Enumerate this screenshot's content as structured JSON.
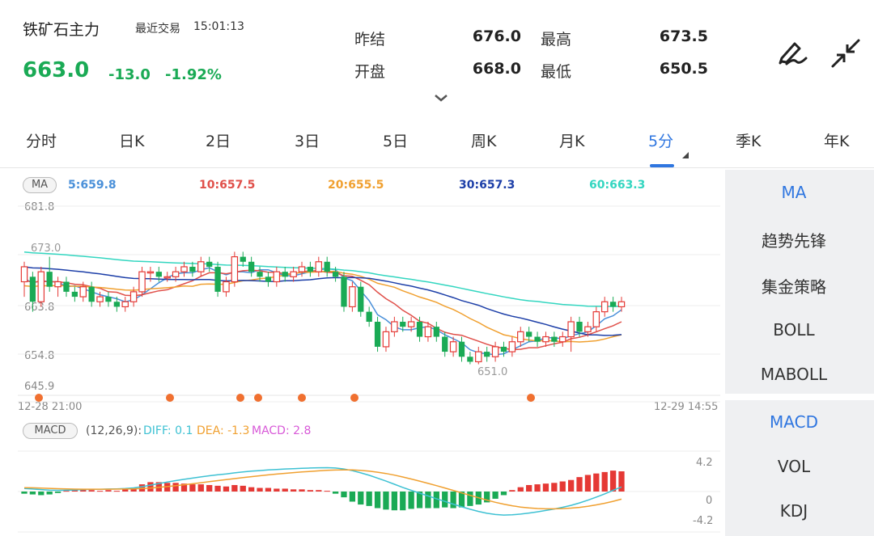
{
  "header": {
    "symbol": "铁矿石主力",
    "trade_label": "最近交易",
    "trade_time": "15:01:13",
    "last_price": "663.0",
    "change": "-13.0",
    "change_pct": "-1.92%",
    "quotes": [
      {
        "label": "昨结",
        "value": "676.0"
      },
      {
        "label": "最高",
        "value": "673.5"
      },
      {
        "label": "开盘",
        "value": "668.0"
      },
      {
        "label": "最低",
        "value": "650.5"
      }
    ],
    "colors": {
      "down": "#1aaa55",
      "up": "#e53935",
      "accent": "#2f76e0"
    }
  },
  "icons": {
    "draw": "draw-pen-icon",
    "collapse": "collapse-arrows-icon",
    "expand": "chevron-down-icon"
  },
  "tabs": [
    "分时",
    "日K",
    "2日",
    "3日",
    "5日",
    "周K",
    "月K",
    "5分",
    "季K",
    "年K"
  ],
  "active_tab": "5分",
  "ma_legend": {
    "badge": "MA",
    "items": [
      {
        "text": "5:659.8",
        "color": "#4a90d9"
      },
      {
        "text": "10:657.5",
        "color": "#e0504a"
      },
      {
        "text": "20:655.5",
        "color": "#f0a030"
      },
      {
        "text": "30:657.3",
        "color": "#1d3fa8"
      },
      {
        "text": "60:663.3",
        "color": "#33d6c0"
      }
    ]
  },
  "price_axis": [
    "681.8",
    "663.8",
    "654.8",
    "645.9"
  ],
  "time_axis": {
    "start": "12-28 21:00",
    "end": "12-29 14:55"
  },
  "annotations": {
    "high": "673.0",
    "low": "651.0"
  },
  "macd_legend": {
    "badge": "MACD",
    "params": "(12,26,9):",
    "diff": "DIFF: 0.1",
    "dea": "DEA: -1.3",
    "macd": "MACD: 2.8"
  },
  "macd_axis": [
    "4.2",
    "0",
    "-4.2"
  ],
  "side_main": [
    "MA",
    "趋势先锋",
    "集金策略",
    "BOLL",
    "MABOLL"
  ],
  "side_sub": [
    "MACD",
    "VOL",
    "KDJ"
  ],
  "chart_data": {
    "type": "candlestick",
    "candles": [
      [
        667,
        670,
        664,
        671
      ],
      [
        668,
        663,
        661,
        669
      ],
      [
        663,
        669,
        662,
        670
      ],
      [
        669,
        666,
        665,
        672
      ],
      [
        666,
        667,
        664,
        668
      ],
      [
        667,
        665,
        664,
        668
      ],
      [
        665,
        664,
        663,
        666
      ],
      [
        664,
        666,
        663,
        667
      ],
      [
        666,
        663,
        662,
        667
      ],
      [
        663,
        664,
        662,
        665
      ],
      [
        664,
        663,
        662,
        665
      ],
      [
        663,
        662,
        661,
        664
      ],
      [
        662,
        663,
        661,
        664
      ],
      [
        663,
        665,
        662,
        666
      ],
      [
        665,
        669,
        664,
        670
      ],
      [
        669,
        669,
        667,
        670
      ],
      [
        669,
        668,
        667,
        670
      ],
      [
        668,
        668,
        667,
        669
      ],
      [
        668,
        669,
        667,
        670
      ],
      [
        669,
        670,
        668,
        671
      ],
      [
        670,
        669,
        668,
        671
      ],
      [
        669,
        671,
        668,
        672
      ],
      [
        671,
        670,
        669,
        672
      ],
      [
        670,
        665,
        664,
        671
      ],
      [
        665,
        667,
        664,
        668
      ],
      [
        667,
        672,
        666,
        673
      ],
      [
        672,
        671,
        670,
        673
      ],
      [
        671,
        669,
        668,
        672
      ],
      [
        669,
        668,
        667,
        670
      ],
      [
        668,
        667,
        666,
        669
      ],
      [
        667,
        669,
        666,
        670
      ],
      [
        669,
        668,
        667,
        670
      ],
      [
        668,
        669,
        667,
        670
      ],
      [
        669,
        670,
        668,
        671
      ],
      [
        670,
        669,
        668,
        671
      ],
      [
        669,
        671,
        668,
        672
      ],
      [
        671,
        669,
        668,
        672
      ],
      [
        669,
        668,
        667,
        670
      ],
      [
        668,
        662,
        661,
        669
      ],
      [
        662,
        666,
        661,
        667
      ],
      [
        666,
        661,
        660,
        667
      ],
      [
        661,
        659,
        658,
        662
      ],
      [
        659,
        654,
        653,
        660
      ],
      [
        654,
        657,
        653,
        658
      ],
      [
        657,
        659,
        656,
        660
      ],
      [
        659,
        658,
        657,
        660
      ],
      [
        658,
        659,
        657,
        660
      ],
      [
        659,
        656,
        655,
        660
      ],
      [
        656,
        658,
        655,
        659
      ],
      [
        658,
        656,
        655,
        659
      ],
      [
        656,
        653,
        652,
        657
      ],
      [
        653,
        655,
        652,
        656
      ],
      [
        655,
        652,
        651,
        656
      ],
      [
        652,
        651,
        650.5,
        653
      ],
      [
        651,
        653,
        650.5,
        654
      ],
      [
        653,
        652,
        651,
        654
      ],
      [
        652,
        654,
        651,
        655
      ],
      [
        654,
        653,
        652,
        655
      ],
      [
        653,
        655,
        652,
        656
      ],
      [
        655,
        657,
        654,
        658
      ],
      [
        657,
        656,
        655,
        658
      ],
      [
        656,
        655,
        654,
        657
      ],
      [
        655,
        656,
        654,
        657
      ],
      [
        656,
        655,
        654,
        657
      ],
      [
        655,
        656,
        654,
        657
      ],
      [
        656,
        659,
        653,
        660
      ],
      [
        659,
        657,
        656,
        660
      ],
      [
        657,
        658,
        656,
        659
      ],
      [
        658,
        661,
        657,
        662
      ],
      [
        661,
        663,
        660,
        664
      ],
      [
        663,
        662,
        661,
        664
      ],
      [
        662,
        663,
        661,
        664
      ]
    ],
    "ma_note": "MA5/MA10/MA20/MA30/MA60",
    "macd_hist": [
      -0.3,
      -0.4,
      -0.5,
      -0.4,
      -0.2,
      0.1,
      0.2,
      0.3,
      0.2,
      0.1,
      0.2,
      0.1,
      0.3,
      0.5,
      1.0,
      1.3,
      1.3,
      1.2,
      1.2,
      1.1,
      1.0,
      1.0,
      0.9,
      0.8,
      0.7,
      0.9,
      0.8,
      0.6,
      0.5,
      0.5,
      0.4,
      0.4,
      0.3,
      0.3,
      0.2,
      0.2,
      0.1,
      -0.3,
      -0.8,
      -1.4,
      -1.8,
      -2.0,
      -2.3,
      -2.5,
      -2.6,
      -2.6,
      -2.4,
      -2.3,
      -2.3,
      -2.3,
      -2.2,
      -2.3,
      -2.2,
      -2.0,
      -1.8,
      -1.5,
      -1.0,
      -0.5,
      0.2,
      0.6,
      0.9,
      1.0,
      1.1,
      1.2,
      1.4,
      1.6,
      2.0,
      2.3,
      2.5,
      2.7,
      2.9,
      2.8
    ],
    "ylim": [
      645.9,
      681.8
    ]
  }
}
